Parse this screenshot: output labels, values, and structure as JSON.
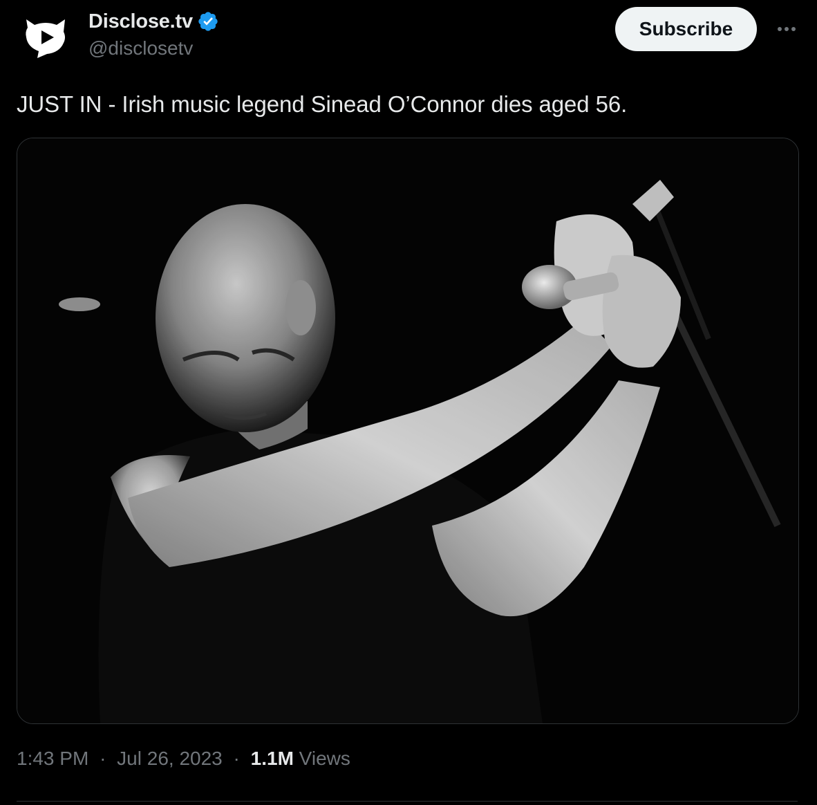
{
  "author": {
    "display_name": "Disclose.tv",
    "handle": "@disclosetv",
    "verified": true,
    "avatar_icon": "disclose-logo-icon"
  },
  "actions": {
    "subscribe_label": "Subscribe",
    "more_icon": "more-horizontal-icon"
  },
  "tweet": {
    "text": "JUST IN - Irish music legend Sinead O’Connor dies aged 56."
  },
  "media": {
    "type": "photo"
  },
  "meta": {
    "time": "1:43 PM",
    "date": "Jul 26, 2023",
    "separator": "·",
    "views_count": "1.1M",
    "views_label": "Views"
  },
  "colors": {
    "background": "#000000",
    "text_primary": "#e7e9ea",
    "text_secondary": "#71767b",
    "verified_blue": "#1d9bf0",
    "button_bg": "#eff3f4",
    "border": "#2f3336"
  }
}
